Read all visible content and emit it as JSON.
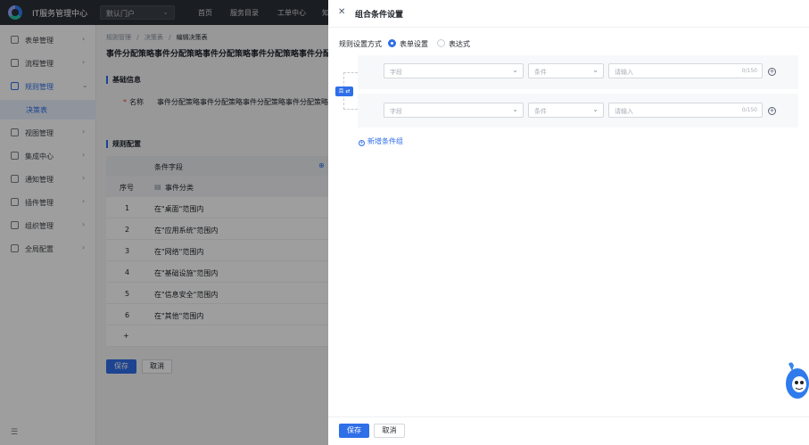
{
  "app": {
    "title": "IT服务管理中心",
    "portal": "默认门户"
  },
  "topnav": [
    "首页",
    "服务目录",
    "工单中心",
    "知"
  ],
  "sidebar": {
    "items": [
      {
        "label": "表单管理",
        "icon": "form-icon"
      },
      {
        "label": "流程管理",
        "icon": "flow-icon"
      },
      {
        "label": "规则管理",
        "icon": "rule-icon"
      },
      {
        "label": "视图管理",
        "icon": "view-icon"
      },
      {
        "label": "集成中心",
        "icon": "integration-icon"
      },
      {
        "label": "通知管理",
        "icon": "bell-icon"
      },
      {
        "label": "插件管理",
        "icon": "plugin-icon"
      },
      {
        "label": "组织管理",
        "icon": "org-icon"
      },
      {
        "label": "全局配置",
        "icon": "settings-icon"
      }
    ],
    "sub_item": "决策表",
    "collapse_icon": "collapse-icon"
  },
  "main": {
    "breadcrumb": [
      "规则管理",
      "/",
      "决策表",
      "/",
      "编辑决策表"
    ],
    "title": "事件分配策略事件分配策略事件分配策略事件分配策略事件分配策",
    "basic_info": "基础信息",
    "name_label": "名称",
    "name_value": "事件分配策略事件分配策略事件分配策略事件分配策略事件分",
    "rule_config": "规则配置",
    "table": {
      "group_header": "条件字段",
      "seq_header": "序号",
      "field_header": "事件分类",
      "rows": [
        {
          "seq": "1",
          "value": "在\"桌面\"范围内"
        },
        {
          "seq": "2",
          "value": "在\"应用系统\"范围内"
        },
        {
          "seq": "3",
          "value": "在\"网络\"范围内"
        },
        {
          "seq": "4",
          "value": "在\"基础设施\"范围内"
        },
        {
          "seq": "5",
          "value": "在\"信息安全\"范围内"
        },
        {
          "seq": "6",
          "value": "在\"其他\"范围内"
        }
      ],
      "add_row": "+"
    },
    "save": "保存",
    "cancel": "取消"
  },
  "drawer": {
    "title": "组合条件设置",
    "mode_label": "规则设置方式",
    "modes": [
      {
        "label": "表单设置",
        "selected": true
      },
      {
        "label": "表达式",
        "selected": false
      }
    ],
    "and_badge": "且 ⇄",
    "conditions": [
      {
        "field_placeholder": "字段",
        "op_placeholder": "条件",
        "value_placeholder": "请输入",
        "count": "0/150"
      },
      {
        "field_placeholder": "字段",
        "op_placeholder": "条件",
        "value_placeholder": "请输入",
        "count": "0/150"
      }
    ],
    "add_group": "新增条件组",
    "save": "保存",
    "cancel": "取消"
  },
  "colors": {
    "accent": "#2f6fe8",
    "topbar": "#2a2f36"
  }
}
